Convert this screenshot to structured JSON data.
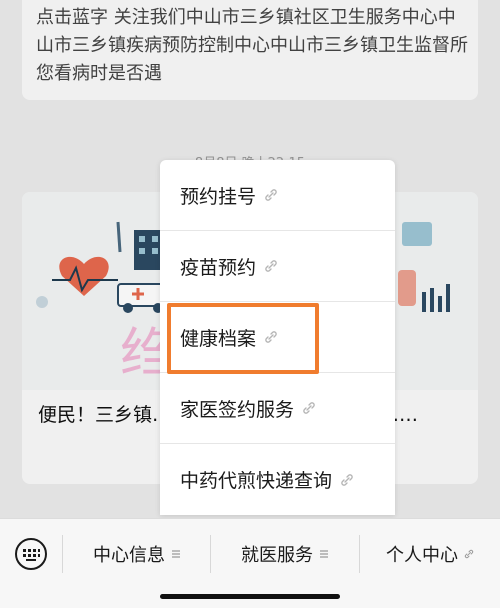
{
  "message": {
    "text": "点击蓝字 关注我们中山市三乡镇社区卫生服务中心中山市三乡镇疾病预防控制中心中山市三乡镇卫生监督所您看病时是否遇"
  },
  "timestamp": "8月8日 晚上22:15",
  "article": {
    "title": "便民！三乡镇……线上结算功能，支持亲……"
  },
  "popup_menu": {
    "items": [
      {
        "label": "预约挂号",
        "icon": "link-icon"
      },
      {
        "label": "疫苗预约",
        "icon": "link-icon"
      },
      {
        "label": "健康档案",
        "icon": "link-icon",
        "highlighted": true
      },
      {
        "label": "家医签约服务",
        "icon": "link-icon"
      },
      {
        "label": "中药代煎快递查询",
        "icon": "link-icon"
      }
    ]
  },
  "bottom_bar": {
    "keyboard_icon": "keyboard-icon",
    "tabs": [
      {
        "label": "中心信息",
        "icon": "menu-lines-icon"
      },
      {
        "label": "就医服务",
        "icon": "menu-lines-icon"
      },
      {
        "label": "个人中心",
        "icon": "link-icon"
      }
    ]
  },
  "colors": {
    "highlight": "#f07c2e",
    "background": "#ececec",
    "card": "#fafafa"
  }
}
